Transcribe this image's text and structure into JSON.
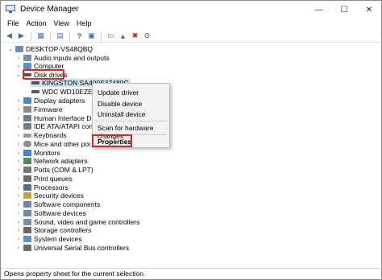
{
  "window": {
    "title": "Device Manager",
    "minimize": "—",
    "maximize": "☐",
    "close": "✕"
  },
  "menu": [
    "File",
    "Action",
    "View",
    "Help"
  ],
  "tree": {
    "root": "DESKTOP-VS48QBQ",
    "categories": [
      "Audio inputs and outputs",
      "Computer",
      "Disk drives",
      "Display adapters",
      "Firmware",
      "Human Interface D",
      "IDE ATA/ATAPI con",
      "Keyboards",
      "Mice and other poi",
      "Monitors",
      "Network adapters",
      "Ports (COM & LPT)",
      "Print queues",
      "Processors",
      "Security devices",
      "Software components",
      "Software devices",
      "Sound, video and game controllers",
      "Storage controllers",
      "System devices",
      "Universal Serial Bus controllers"
    ],
    "disk_children": [
      "KINGSTON SA400S37480G",
      "WDC WD10EZE"
    ]
  },
  "context_menu": {
    "items": [
      "Update driver",
      "Disable device",
      "Uninstall device",
      "Scan for hardware changes",
      "Properties"
    ]
  },
  "status": "Opens property sheet for the current selection.",
  "colors": {
    "highlight": "#e0231e",
    "selection": "#cce4f7"
  }
}
